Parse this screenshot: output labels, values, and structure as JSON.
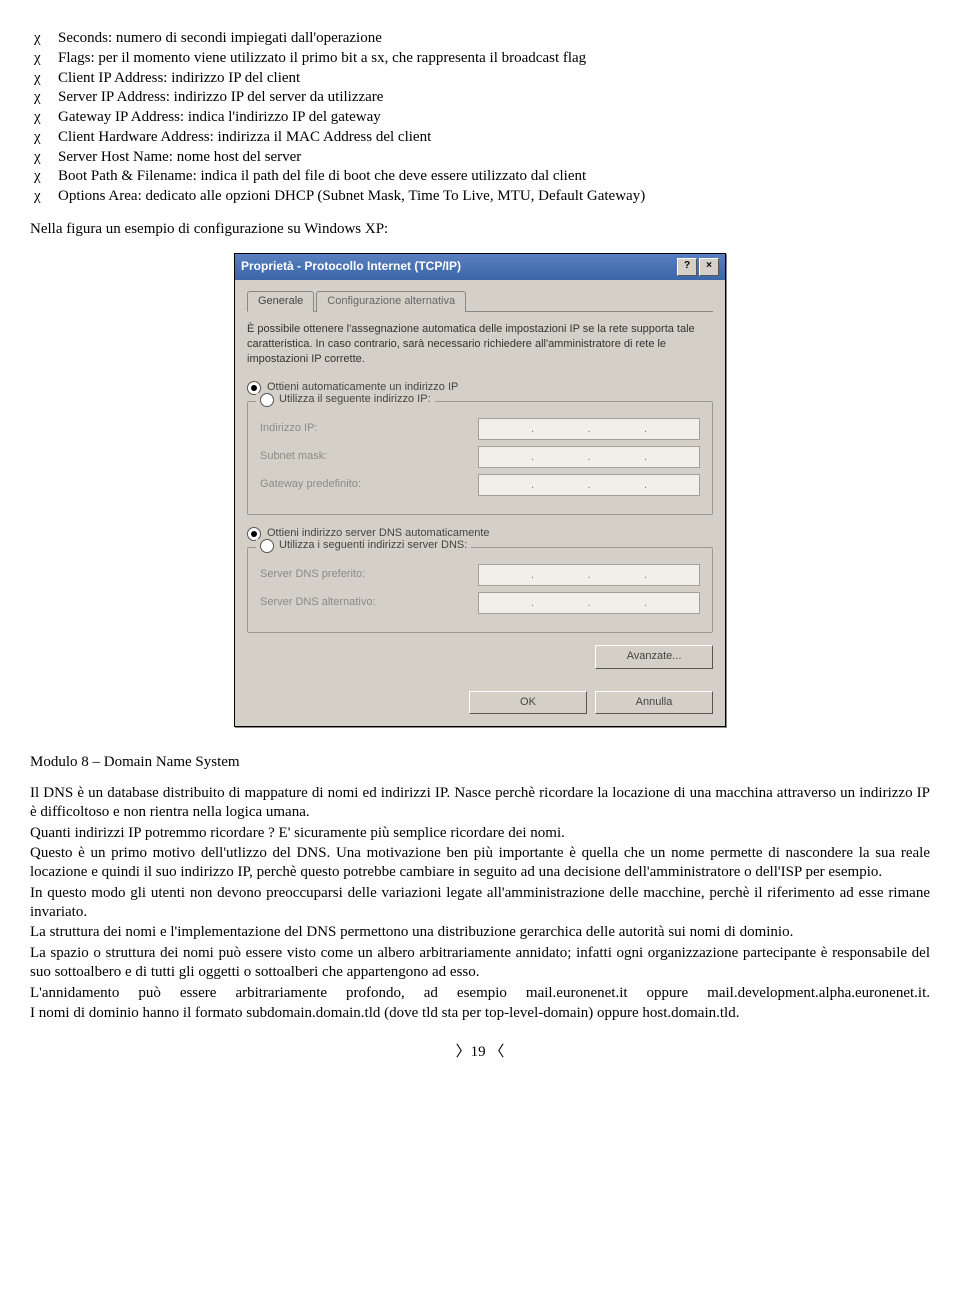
{
  "bullets": [
    "Seconds: numero di secondi impiegati dall'operazione",
    "Flags: per il momento viene utilizzato il primo bit a sx, che rappresenta il broadcast flag",
    "Client IP Address: indirizzo IP del client",
    "Server IP Address: indirizzo IP del server da utilizzare",
    "Gateway IP Address: indica l'indirizzo IP del gateway",
    "Client Hardware Address: indirizza il MAC Address del client",
    "Server Host Name: nome host del server",
    "Boot Path & Filename: indica il path del file di boot che deve essere utilizzato dal client",
    "Options Area: dedicato alle opzioni DHCP (Subnet Mask, Time To Live, MTU, Default Gateway)"
  ],
  "intro": "Nella figura un esempio di configurazione su Windows XP:",
  "dialog": {
    "title": "Proprietà - Protocollo Internet (TCP/IP)",
    "tab_general": "Generale",
    "tab_alt": "Configurazione alternativa",
    "desc": "È possibile ottenere l'assegnazione automatica delle impostazioni IP se la rete supporta tale caratteristica. In caso contrario, sarà necessario richiedere all'amministratore di rete le impostazioni IP corrette.",
    "r_auto_ip": "Ottieni automaticamente un indirizzo IP",
    "r_manual_ip": "Utilizza il seguente indirizzo IP:",
    "lbl_ip": "Indirizzo IP:",
    "lbl_subnet": "Subnet mask:",
    "lbl_gateway": "Gateway predefinito:",
    "r_auto_dns": "Ottieni indirizzo server DNS automaticamente",
    "r_manual_dns": "Utilizza i seguenti indirizzi server DNS:",
    "lbl_dns1": "Server DNS preferito:",
    "lbl_dns2": "Server DNS alternativo:",
    "btn_adv": "Avanzate...",
    "btn_ok": "OK",
    "btn_cancel": "Annulla"
  },
  "section_title": "Modulo 8 – Domain Name System",
  "paragraphs": [
    "Il DNS è un database distribuito di mappature di nomi ed indirizzi IP. Nasce perchè ricordare la locazione di una macchina attraverso un indirizzo IP è difficoltoso e non rientra nella logica umana.",
    "Quanti indirizzi IP potremmo ricordare ? E' sicuramente più semplice ricordare dei nomi.",
    "Questo è un primo motivo dell'utlizzo del DNS. Una motivazione ben più importante è quella che un nome permette di nascondere la sua reale locazione e quindi il suo indirizzo IP, perchè questo potrebbe cambiare in seguito ad una decisione dell'amministratore o dell'ISP per esempio.",
    "In questo modo gli utenti non devono preoccuparsi delle variazioni legate all'amministrazione delle macchine, perchè il riferimento ad esse rimane invariato.",
    "La struttura dei nomi e l'implementazione del DNS permettono una distribuzione gerarchica delle autorità sui nomi di dominio.",
    "La spazio o struttura dei nomi può essere visto come un albero arbitrariamente annidato; infatti ogni organizzazione partecipante è responsabile del suo sottoalbero e di tutti gli oggetti o sottoalberi che appartengono ad esso.",
    "L'annidamento può essere arbitrariamente profondo, ad esempio mail.euronenet.it oppure mail.development.alpha.euronenet.it.",
    "I nomi di dominio hanno il formato subdomain.domain.tld (dove tld sta per top-level-domain) oppure host.domain.tld."
  ],
  "page_number": "〉19 〈"
}
